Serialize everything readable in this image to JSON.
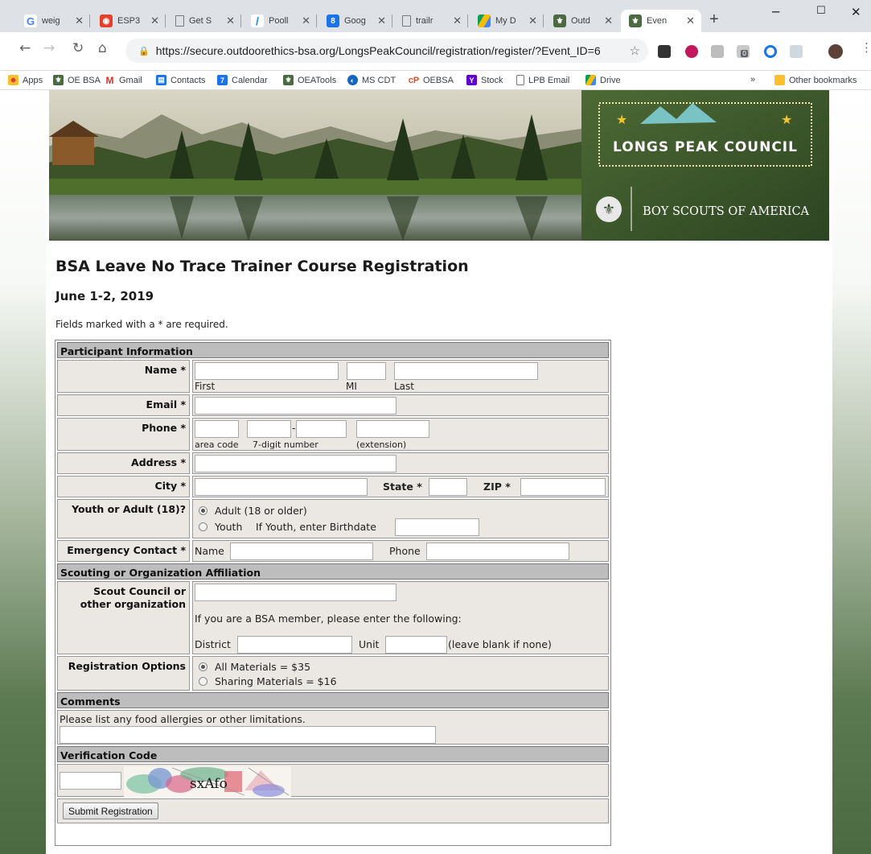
{
  "browser": {
    "tabs": [
      {
        "title": "weig",
        "icon": "google-icon",
        "color": "#4285f4"
      },
      {
        "title": "ESP3",
        "icon": "rss-icon",
        "color": "#e5402b"
      },
      {
        "title": "Get S",
        "icon": "document-icon",
        "color": "#5f6368"
      },
      {
        "title": "Pooll",
        "icon": "pooll-icon",
        "color": "#1e88e5"
      },
      {
        "title": "Goog",
        "icon": "calendar-icon",
        "color": "#1a73e8"
      },
      {
        "title": "trailr",
        "icon": "document-icon",
        "color": "#5f6368"
      },
      {
        "title": "My D",
        "icon": "drive-icon",
        "color": "#fbbc04"
      },
      {
        "title": "Outd",
        "icon": "bsa-icon",
        "color": "#4b6a41"
      },
      {
        "title": "Even",
        "icon": "bsa-icon",
        "color": "#4b6a41",
        "active": true
      }
    ],
    "url": "https://secure.outdoorethics-bsa.org/LongsPeakCouncil/registration/register/?Event_ID=6",
    "bookmarks": [
      "Apps",
      "OE BSA",
      "Gmail",
      "Contacts",
      "Calendar",
      "OEATools",
      "MS CDT",
      "OEBSA",
      "Stock",
      "LPB Email",
      "Drive"
    ],
    "other_bookmarks": "Other bookmarks",
    "more": "»",
    "ext_badge": "0"
  },
  "banner": {
    "council": "LONGS PEAK COUNCIL",
    "org": "BOY SCOUTS OF AMERICA"
  },
  "page": {
    "title": "BSA Leave No Trace Trainer Course Registration",
    "date": "June 1-2, 2019",
    "required_note": "Fields marked with a * are required."
  },
  "form": {
    "sections": {
      "participant": "Participant Information",
      "affiliation": "Scouting or Organization Affiliation",
      "comments": "Comments",
      "verification": "Verification Code"
    },
    "name": {
      "label": "Name *",
      "first": "First",
      "mi": "MI",
      "last": "Last"
    },
    "email": {
      "label": "Email *"
    },
    "phone": {
      "label": "Phone *",
      "dash": "-",
      "area": "area code",
      "number": "7-digit number",
      "ext": "(extension)"
    },
    "address": {
      "label": "Address *"
    },
    "city": {
      "label": "City *",
      "state": "State *",
      "zip": "ZIP *"
    },
    "age": {
      "label": "Youth or Adult (18)?",
      "adult": "Adult (18 or older)",
      "youth": "Youth",
      "birthdate": "If Youth, enter Birthdate",
      "selected": "adult"
    },
    "emergency": {
      "label": "Emergency Contact *",
      "name": "Name",
      "phone": "Phone"
    },
    "council": {
      "label1": "Scout Council or",
      "label2": "other organization",
      "bsa_note": "If you are a BSA member, please enter the following:",
      "district": "District",
      "unit": "Unit",
      "unit_note": "(leave blank if none)"
    },
    "options": {
      "label": "Registration Options",
      "all": "All Materials = $35",
      "sharing": "Sharing Materials = $16",
      "selected": "all"
    },
    "comments_note": "Please list any food allergies or other limitations.",
    "captcha_text": "sxAfo",
    "submit": "Submit Registration"
  }
}
